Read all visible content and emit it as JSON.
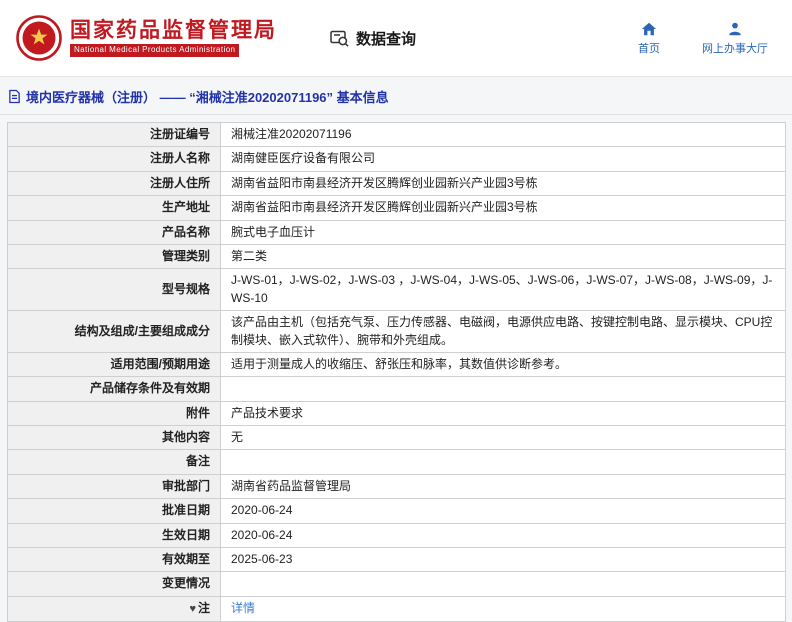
{
  "header": {
    "agency_cn": "国家药品监督管理局",
    "agency_en": "National Medical Products Administration",
    "section_label": "数据查询",
    "nav_home": "首页",
    "nav_hall": "网上办事大厅"
  },
  "page": {
    "title": "境内医疗器械（注册） —— “湘械注准20202071196” 基本信息"
  },
  "table": {
    "rows": [
      {
        "label": "注册证编号",
        "value": "湘械注准20202071196"
      },
      {
        "label": "注册人名称",
        "value": "湖南健臣医疗设备有限公司"
      },
      {
        "label": "注册人住所",
        "value": "湖南省益阳市南县经济开发区腾辉创业园新兴产业园3号栋"
      },
      {
        "label": "生产地址",
        "value": "湖南省益阳市南县经济开发区腾辉创业园新兴产业园3号栋"
      },
      {
        "label": "产品名称",
        "value": "腕式电子血压计"
      },
      {
        "label": "管理类别",
        "value": "第二类"
      },
      {
        "label": "型号规格",
        "value": "J-WS-01，J-WS-02，J-WS-03 ，J-WS-04，J-WS-05、J-WS-06，J-WS-07，J-WS-08，J-WS-09，J-WS-10"
      },
      {
        "label": "结构及组成/主要组成成分",
        "value": "该产品由主机（包括充气泵、压力传感器、电磁阀，电源供应电路、按键控制电路、显示模块、CPU控制模块、嵌入式软件）、腕带和外壳组成。"
      },
      {
        "label": "适用范围/预期用途",
        "value": "适用于测量成人的收缩压、舒张压和脉率，其数值供诊断参考。"
      },
      {
        "label": "产品储存条件及有效期",
        "value": ""
      },
      {
        "label": "附件",
        "value": "产品技术要求"
      },
      {
        "label": "其他内容",
        "value": "无"
      },
      {
        "label": "备注",
        "value": ""
      },
      {
        "label": "审批部门",
        "value": "湖南省药品监督管理局"
      },
      {
        "label": "批准日期",
        "value": "2020-06-24"
      },
      {
        "label": "生效日期",
        "value": "2020-06-24"
      },
      {
        "label": "有效期至",
        "value": "2025-06-23"
      },
      {
        "label": "变更情况",
        "value": ""
      },
      {
        "label": "注",
        "value": "详情",
        "link": true,
        "label_icon": "note-icon",
        "icon_glyph": "♥"
      }
    ]
  },
  "colors": {
    "brand_red": "#c01920",
    "title_blue": "#2233aa",
    "link_blue": "#3b7fd4",
    "nav_blue": "#2a66b5"
  }
}
